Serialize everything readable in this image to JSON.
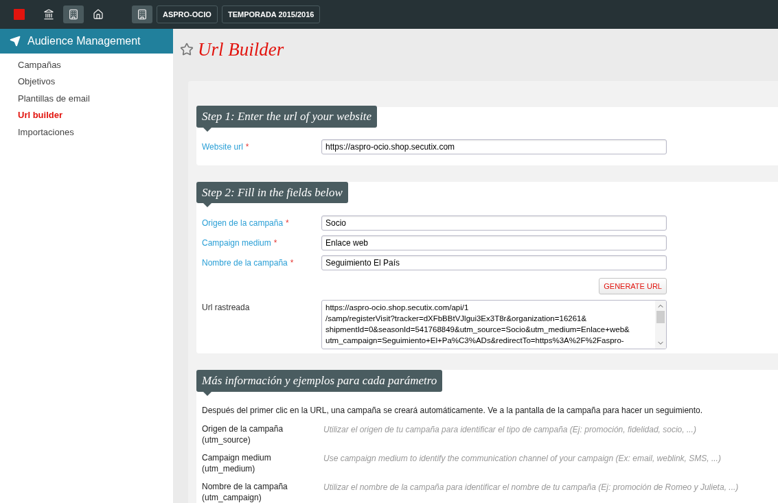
{
  "topbar": {
    "nav_icons": [
      {
        "kind": "bank",
        "selected": false
      },
      {
        "kind": "building",
        "selected": true
      },
      {
        "kind": "home",
        "selected": false
      }
    ],
    "context_buttons": [
      "ASPRO-OCIO",
      "TEMPORADA 2015/2016"
    ]
  },
  "sidebar": {
    "title": "Audience Management",
    "items": [
      {
        "label": "Campañas",
        "selected": false
      },
      {
        "label": "Objetivos",
        "selected": false
      },
      {
        "label": "Plantillas de email",
        "selected": false
      },
      {
        "label": "Url builder",
        "selected": true
      },
      {
        "label": "Importaciones",
        "selected": false
      }
    ]
  },
  "page": {
    "title": "Url Builder",
    "favorite": false
  },
  "step1": {
    "heading": "Step 1: Enter the url of your website",
    "fields": [
      {
        "label": "Website url",
        "required_mark": "*",
        "value": "https://aspro-ocio.shop.secutix.com"
      }
    ]
  },
  "step2": {
    "heading": "Step 2: Fill in the fields below",
    "fields": [
      {
        "label": "Origen de la campaña",
        "required_mark": "*",
        "value": "Socio"
      },
      {
        "label": "Campaign medium",
        "required_mark": "*",
        "value": "Enlace web"
      },
      {
        "label": "Nombre de la campaña",
        "required_mark": "*",
        "value": "Seguimiento El País"
      }
    ],
    "button": "GENERATE URL",
    "result_label": "Url rastreada",
    "result_value": "https://aspro-ocio.shop.secutix.com/api/1\n/samp/registerVisit?tracker=dXFbBBtVJlgui3Ex3T8r&organization=16261&\nshipmentId=0&seasonId=541768849&utm_source=Socio&utm_medium=Enlace+web&\nutm_campaign=Seguimiento+El+Pa%C3%ADs&redirectTo=https%3A%2F%2Faspro-"
  },
  "info": {
    "heading": "Más información y ejemplos para cada parámetro",
    "intro": "Después del primer clic en la URL, una campaña se creará automáticamente. Ve a la pantalla de la campaña para hacer un seguimiento.",
    "params": [
      {
        "name": "Origen de la campaña",
        "code": "(utm_source)",
        "description": "Utilizar el origen de tu campaña para identificar el tipo de campaña (Ej: promoción, fidelidad, socio, ...)"
      },
      {
        "name": "Campaign medium",
        "code": "(utm_medium)",
        "description": "Use campaign medium to identify the communication channel of your campaign (Ex: email, weblink, SMS, ...)"
      },
      {
        "name": "Nombre de la campaña",
        "code": "(utm_campaign)",
        "description": "Utilizar el nombre de la campaña para identificar el nombre de tu campaña (Ej: promoción de Romeo y Julieta, ...)"
      }
    ]
  }
}
